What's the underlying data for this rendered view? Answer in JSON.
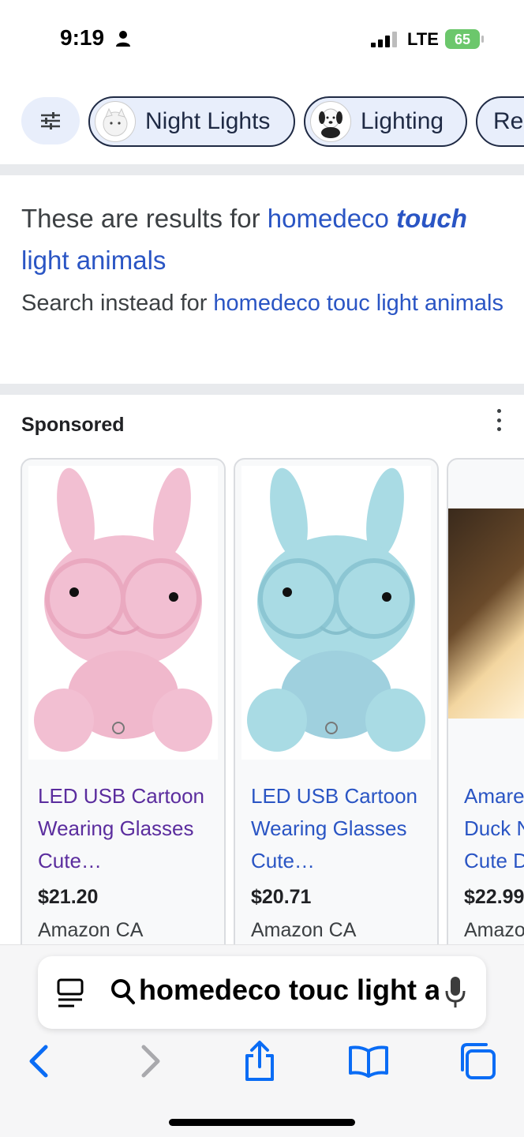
{
  "status_bar": {
    "time": "9:19",
    "network": "LTE",
    "battery": "65"
  },
  "chips": [
    {
      "label": "Night Lights",
      "icon": "night-light-thumbnail"
    },
    {
      "label": "Lighting",
      "icon": "dog-lamp-thumbnail"
    },
    {
      "label": "Re"
    }
  ],
  "correction": {
    "prefix": "These are results for",
    "query_part1": "homedeco",
    "query_bold": "touch",
    "query_part2": "light animals",
    "instead_prefix": "Search instead for",
    "instead_query": "homedeco touc light animals"
  },
  "sponsored": {
    "label": "Sponsored"
  },
  "products": [
    {
      "title": "LED USB Cartoon Wearing Glasses Cute…",
      "price": "$21.20",
      "store": "Amazon CA",
      "color": "#f2bfd2"
    },
    {
      "title": "LED USB Cartoon Wearing Glasses Cute…",
      "price": "$20.71",
      "store": "Amazon CA",
      "color": "#a9dbe4"
    },
    {
      "title_lines": [
        "Amare",
        "Duck N",
        "Cute D"
      ],
      "price": "$22.99",
      "store": "Amazo"
    }
  ],
  "browser": {
    "url_text": "homedeco touc light animals"
  },
  "colors": {
    "link": "#2a55c4",
    "visited": "#5b2d9e",
    "accent": "#0a6cf5",
    "chip_bg": "#e8eefb"
  }
}
